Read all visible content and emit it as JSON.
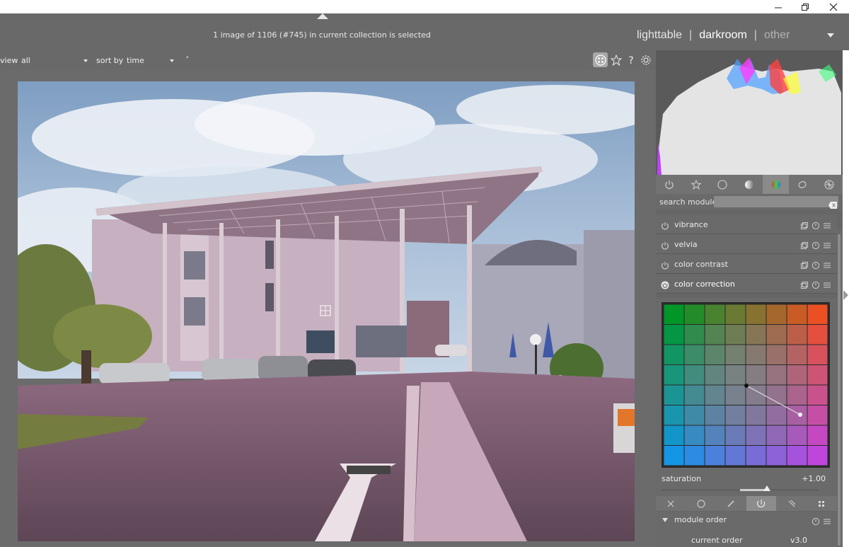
{
  "window": {
    "controls": [
      "minimize-icon",
      "restore-icon",
      "close-icon"
    ]
  },
  "header": {
    "selection_status": "1 image of 1106 (#745) in current collection is selected",
    "views": {
      "lighttable": "lighttable",
      "darkroom": "darkroom",
      "other": "other",
      "separator": "|"
    }
  },
  "filterbar": {
    "view_label": "view",
    "view_value": "all",
    "sort_label": "sort by",
    "sort_value": "time",
    "sort_order": "˄",
    "icons": [
      "grid-icon",
      "star-icon",
      "help-icon",
      "gear-icon"
    ]
  },
  "right_panel": {
    "group_icons": [
      "power-icon",
      "favorites-star-icon",
      "base-circle-icon",
      "tone-circle-icon",
      "color-circle-icon",
      "correct-shapes-icon",
      "effect-icon"
    ],
    "active_group_index": 4,
    "search": {
      "label": "search module",
      "placeholder": ""
    },
    "modules": [
      {
        "name": "vibrance",
        "expanded": false
      },
      {
        "name": "velvia",
        "expanded": false
      },
      {
        "name": "color contrast",
        "expanded": false
      },
      {
        "name": "color correction",
        "expanded": true
      }
    ],
    "color_correction": {
      "saturation_label": "saturation",
      "saturation_value": "+1.00",
      "saturation": 1.0
    },
    "bottom_icons": [
      "reset-x-icon",
      "circle-mask-icon",
      "brush-mask-icon",
      "parametric-mask-icon",
      "combined-mask-icon",
      "raster-mask-icon"
    ],
    "active_bottom_index": 3,
    "module_order": {
      "title": "module order",
      "current_label": "current order",
      "current_value": "v3.0"
    }
  },
  "colors": {
    "panel_bg": "#6a6a6a",
    "header_bg": "#696969",
    "text": "#ececec"
  }
}
